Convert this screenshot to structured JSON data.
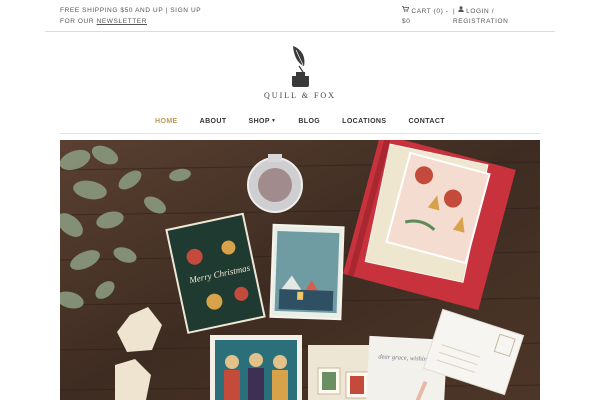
{
  "topbar": {
    "promo_text": "FREE SHIPPING $50 AND UP | SIGN UP FOR OUR",
    "newsletter_link": "NEWSLETTER",
    "cart_text": "CART (0) - $0",
    "login_text": "LOGIN / REGISTRATION",
    "separator": "|"
  },
  "brand": {
    "name": "QUILL & FOX"
  },
  "nav": {
    "items": [
      {
        "label": "HOME"
      },
      {
        "label": "ABOUT"
      },
      {
        "label": "SHOP"
      },
      {
        "label": "BLOG"
      },
      {
        "label": "LOCATIONS"
      },
      {
        "label": "CONTACT"
      }
    ],
    "active": "HOME"
  },
  "hero": {
    "card_text": "Merry Christmas",
    "letter_text": "dear grace, wishing you and yours a merry"
  },
  "colors": {
    "accent": "#b89a5c",
    "wood": "#4a3426",
    "red_book": "#c8323c"
  },
  "icons": {
    "cart": "cart-icon",
    "user": "user-icon",
    "logo": "inkwell-quill-icon",
    "dropdown": "caret-down-icon"
  }
}
